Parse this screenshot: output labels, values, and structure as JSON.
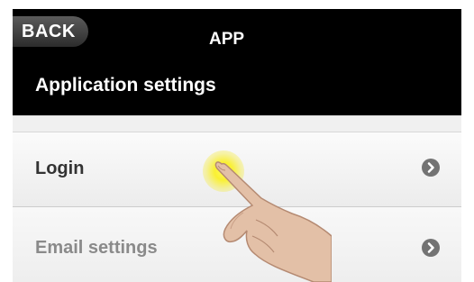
{
  "header": {
    "back_label": "BACK",
    "app_title": "APP"
  },
  "section": {
    "title": "Application settings"
  },
  "settings": {
    "items": [
      {
        "label": "Login",
        "icon": "chevron-right-icon"
      },
      {
        "label": "Email settings",
        "icon": "chevron-right-icon"
      }
    ]
  },
  "colors": {
    "header_background": "#000000",
    "tap_highlight": "#f5ec2a",
    "list_background": "#f0f0f0"
  }
}
